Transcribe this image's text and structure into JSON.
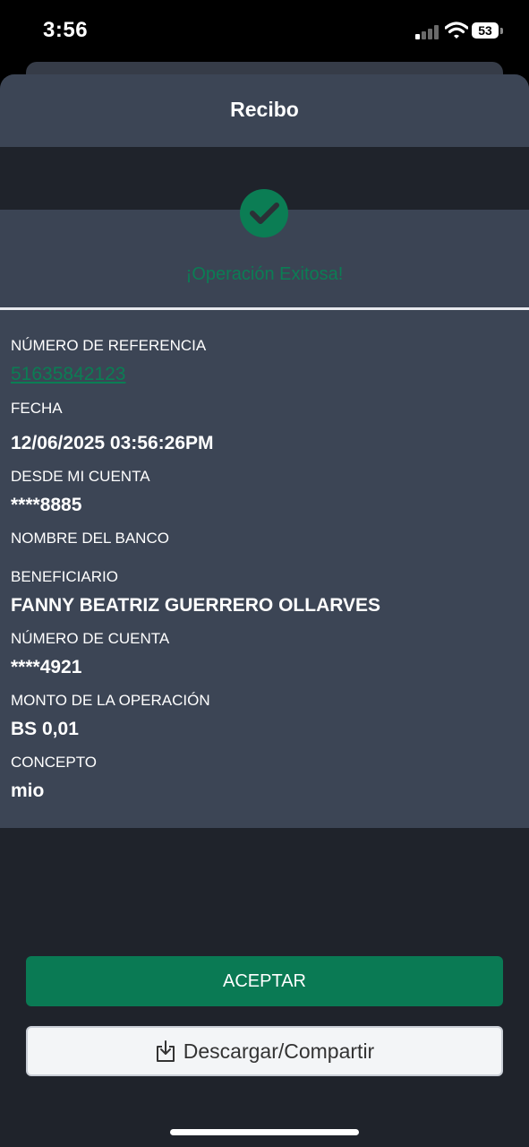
{
  "status_bar": {
    "time": "3:56",
    "battery": "53"
  },
  "header": {
    "title": "Recibo"
  },
  "success": {
    "message": "¡Operación Exitosa!"
  },
  "details": {
    "reference": {
      "label": "NÚMERO DE REFERENCIA",
      "value": "51635842123"
    },
    "date": {
      "label": "FECHA",
      "value": "12/06/2025 03:56:26PM"
    },
    "from_account": {
      "label": "DESDE MI CUENTA",
      "value": "****8885"
    },
    "bank_name": {
      "label": "NOMBRE DEL BANCO",
      "value": ""
    },
    "beneficiary": {
      "label": "BENEFICIARIO",
      "value": "FANNY BEATRIZ GUERRERO OLLARVES"
    },
    "account_number": {
      "label": "NÚMERO DE CUENTA",
      "value": "****4921"
    },
    "amount": {
      "label": "MONTO DE LA OPERACIÓN",
      "value": "BS 0,01"
    },
    "concept": {
      "label": "CONCEPTO",
      "value": "mio"
    }
  },
  "actions": {
    "accept_label": "ACEPTAR",
    "share_label": "Descargar/Compartir"
  },
  "colors": {
    "accent": "#0b7d54",
    "header_bg": "#3c4555",
    "sheet_bg": "#1f232b"
  }
}
